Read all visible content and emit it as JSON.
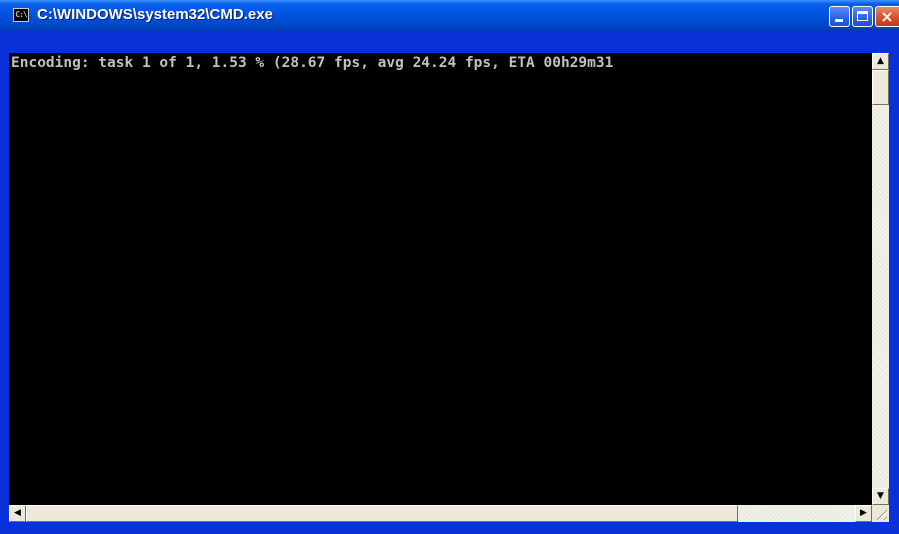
{
  "window": {
    "title": "C:\\WINDOWS\\system32\\CMD.exe",
    "icon": "cmd-icon",
    "icon_text": "C:\\"
  },
  "title_buttons": {
    "minimize_icon": "minimize-icon",
    "maximize_icon": "maximize-icon",
    "close_icon": "close-icon",
    "close_glyph": "×"
  },
  "console": {
    "lines": [
      "Encoding: task 1 of 1, 1.53 % (28.67 fps, avg 24.24 fps, ETA 00h29m31"
    ]
  },
  "scrollbars": {
    "up_arrow": "▲",
    "down_arrow": "▼",
    "left_arrow": "◀",
    "right_arrow": "▶"
  },
  "colors": {
    "titlebar": "#0054e3",
    "console_bg": "#000000",
    "console_text": "#c0c0c0"
  }
}
